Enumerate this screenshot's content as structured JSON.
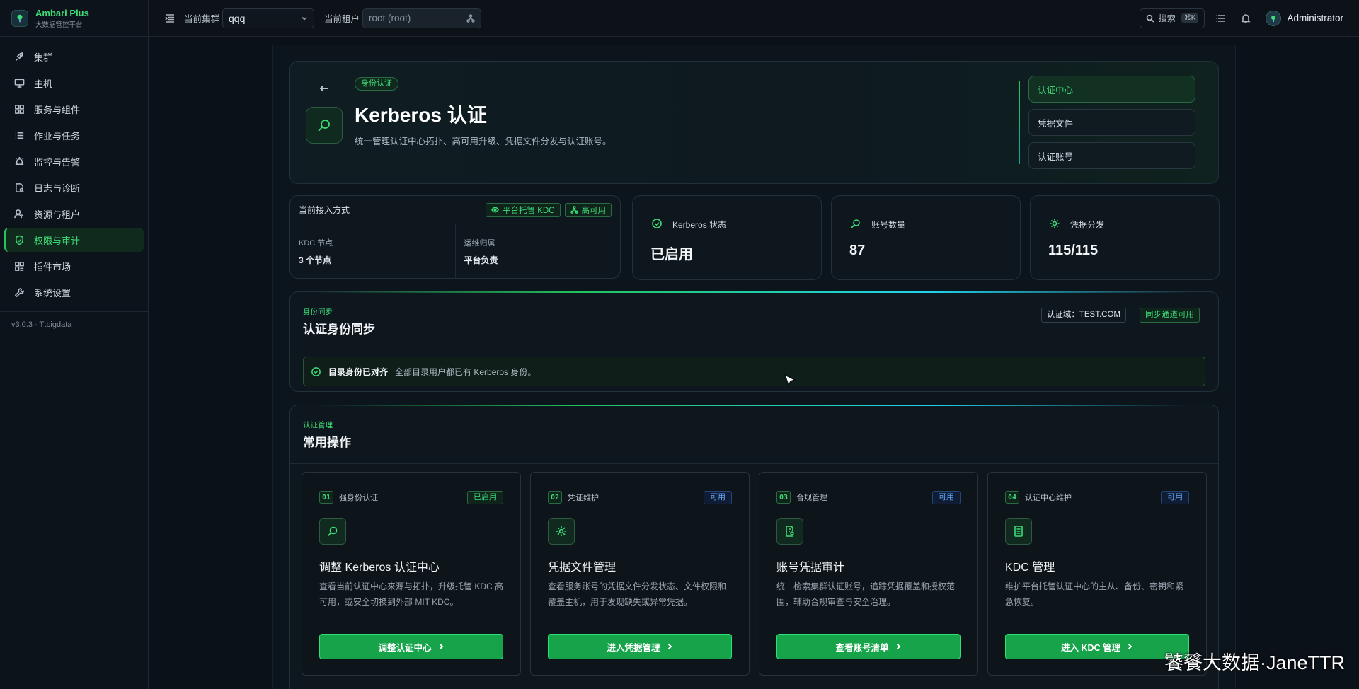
{
  "brand": {
    "name": "Ambari Plus",
    "subtitle": "大数据管控平台"
  },
  "sidebar": {
    "items": [
      {
        "label": "集群",
        "icon": "rocket-icon"
      },
      {
        "label": "主机",
        "icon": "monitor-icon"
      },
      {
        "label": "服务与组件",
        "icon": "grid-icon"
      },
      {
        "label": "作业与任务",
        "icon": "list-icon"
      },
      {
        "label": "监控与告警",
        "icon": "alarm-icon"
      },
      {
        "label": "日志与诊断",
        "icon": "file-search-icon"
      },
      {
        "label": "资源与租户",
        "icon": "users-icon"
      },
      {
        "label": "权限与审计",
        "icon": "shield-check-icon",
        "active": true
      },
      {
        "label": "插件市场",
        "icon": "puzzle-icon"
      },
      {
        "label": "系统设置",
        "icon": "wrench-icon"
      }
    ],
    "version": "v3.0.3 · Ttbigdata"
  },
  "topbar": {
    "cluster_label": "当前集群",
    "cluster_value": "qqq",
    "tenant_label": "当前租户",
    "tenant_placeholder": "root (root)",
    "search_label": "搜索",
    "search_shortcut": "⌘K",
    "username": "Administrator"
  },
  "hero": {
    "tag": "身份认证",
    "title": "Kerberos 认证",
    "description": "统一管理认证中心拓扑、高可用升级、凭据文件分发与认证账号。",
    "nav": [
      {
        "label": "认证中心",
        "active": true
      },
      {
        "label": "凭据文件"
      },
      {
        "label": "认证账号"
      }
    ]
  },
  "access": {
    "title": "当前接入方式",
    "badges": [
      "平台托管 KDC",
      "高可用"
    ],
    "cols": [
      {
        "label": "KDC 节点",
        "value": "3 个节点"
      },
      {
        "label": "运维归属",
        "value": "平台负责"
      }
    ]
  },
  "stats": [
    {
      "label": "Kerberos 状态",
      "value": "已启用",
      "icon": "check-circle-icon"
    },
    {
      "label": "账号数量",
      "value": "87",
      "icon": "search-icon"
    },
    {
      "label": "凭据分发",
      "value": "115/115",
      "icon": "gear-icon"
    }
  ],
  "sync": {
    "kicker": "身份同步",
    "title": "认证身份同步",
    "realm": "认证域：TEST.COM",
    "status": "同步通道可用",
    "alert_title": "目录身份已对齐",
    "alert_text": "全部目录用户都已有 Kerberos 身份。"
  },
  "ops": {
    "kicker": "认证管理",
    "title": "常用操作",
    "cards": [
      {
        "num": "01",
        "category": "强身份认证",
        "status": "已启用",
        "status_type": "on",
        "icon": "search-icon",
        "title": "调整 Kerberos 认证中心",
        "desc": "查看当前认证中心来源与拓扑，升级托管 KDC 高可用，或安全切换到外部 MIT KDC。",
        "button": "调整认证中心"
      },
      {
        "num": "02",
        "category": "凭证维护",
        "status": "可用",
        "status_type": "avail",
        "icon": "gear-icon",
        "title": "凭据文件管理",
        "desc": "查看服务账号的凭据文件分发状态、文件权限和覆盖主机，用于发现缺失或异常凭据。",
        "button": "进入凭据管理"
      },
      {
        "num": "03",
        "category": "合规管理",
        "status": "可用",
        "status_type": "avail",
        "icon": "audit-icon",
        "title": "账号凭据审计",
        "desc": "统一检索集群认证账号，追踪凭据覆盖和授权范围，辅助合规审查与安全治理。",
        "button": "查看账号清单"
      },
      {
        "num": "04",
        "category": "认证中心维护",
        "status": "可用",
        "status_type": "avail",
        "icon": "server-icon",
        "title": "KDC 管理",
        "desc": "维护平台托管认证中心的主从、备份、密钥和紧急恢复。",
        "button": "进入 KDC 管理"
      }
    ]
  },
  "watermark": "饕餮大数据·JaneTTR"
}
